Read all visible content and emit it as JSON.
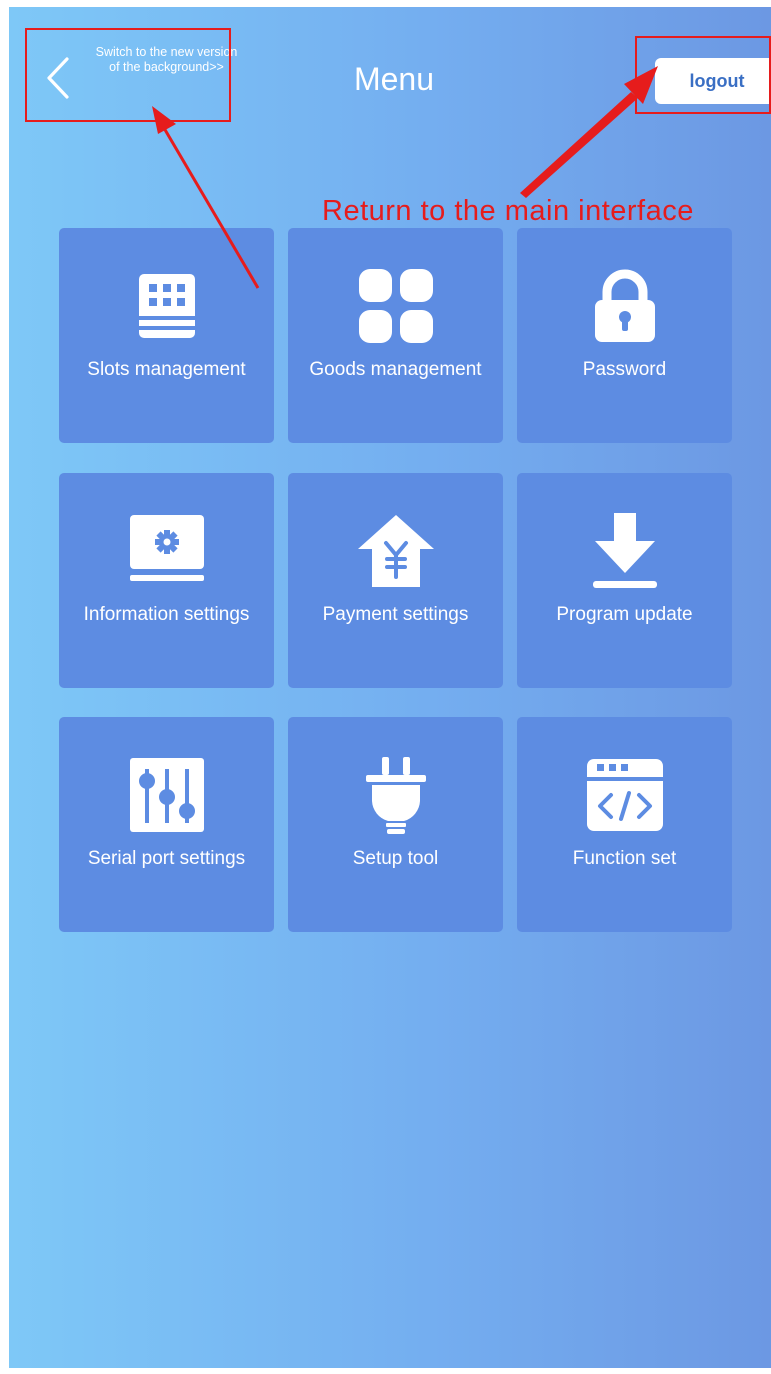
{
  "header": {
    "switch_text": "Switch to the new version of the background>>",
    "title": "Menu",
    "logout_label": "logout"
  },
  "annotation": {
    "text": "Return to the main interface",
    "color": "#e61c1c"
  },
  "menu": {
    "items": [
      {
        "label": "Slots management",
        "icon": "vending-machine-icon"
      },
      {
        "label": "Goods management",
        "icon": "grid-icon"
      },
      {
        "label": "Password",
        "icon": "lock-icon"
      },
      {
        "label": "Information settings",
        "icon": "monitor-gear-icon"
      },
      {
        "label": "Payment settings",
        "icon": "yen-house-icon"
      },
      {
        "label": "Program update",
        "icon": "download-icon"
      },
      {
        "label": "Serial port settings",
        "icon": "sliders-icon"
      },
      {
        "label": "Setup tool",
        "icon": "plug-icon"
      },
      {
        "label": "Function set",
        "icon": "code-window-icon"
      }
    ]
  },
  "colors": {
    "tile": "#5d8ce2",
    "background_start": "#7ec8f7",
    "background_end": "#6c98e3",
    "logout_text": "#3a6fc4"
  }
}
